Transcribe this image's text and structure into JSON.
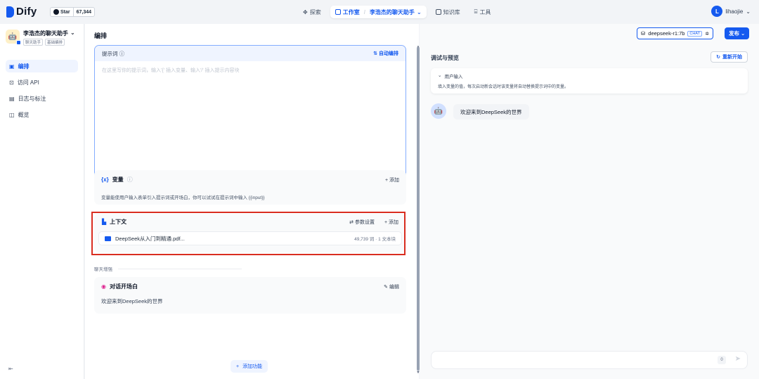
{
  "topbar": {
    "logo": "Dify",
    "star_label": "Star",
    "star_count": "67,344",
    "nav": {
      "explore": "探索",
      "studio": "工作室",
      "app_name": "李浩杰的聊天助手",
      "knowledge": "知识库",
      "tools": "工具"
    },
    "user_initial": "L",
    "user_name": "lihaojie"
  },
  "sidebar": {
    "app_name": "李浩杰的聊天助手",
    "app_tags": [
      "聊天助手",
      "基础编排"
    ],
    "items": [
      {
        "label": "编排"
      },
      {
        "label": "访问 API"
      },
      {
        "label": "日志与标注"
      },
      {
        "label": "概览"
      }
    ],
    "collapse_icon": "⇤"
  },
  "editor": {
    "title": "编排",
    "prompt": {
      "label": "提示词",
      "auto": "自动编排",
      "placeholder": "在这里写你的提示词，输入'{' 插入变量、输入'/' 插入提示内容块",
      "count": "0"
    },
    "variables": {
      "title": "变量",
      "add": "添加",
      "desc": "变量能使用户输入表单引入提示词或开场白，你可以试试在提示词中输入 {{input}}"
    },
    "context": {
      "title": "上下文",
      "params": "参数设置",
      "add": "添加",
      "file_name": "DeepSeek从入门到精通.pdf...",
      "file_meta": "49,739 词 · 1 文本块"
    },
    "enhance_label": "聊天增强",
    "opener": {
      "title": "对话开场白",
      "edit": "编辑",
      "text": "欢迎来到DeepSeek的世界"
    },
    "add_feature": "添加功能"
  },
  "preview": {
    "model": "deepseek-r1:7b",
    "chat_badge": "CHAT",
    "publish": "发布",
    "title": "调试与预览",
    "restart": "重新开始",
    "user_input_title": "用户输入",
    "user_input_desc": "填入变量的值，每次启动新会话时该变量将自动替换提示词中的变量。",
    "bot_message": "欢迎来到DeepSeek的世界",
    "input_count": "0"
  },
  "colors": {
    "accent": "#155aef",
    "highlight_frame": "#d92d20"
  }
}
